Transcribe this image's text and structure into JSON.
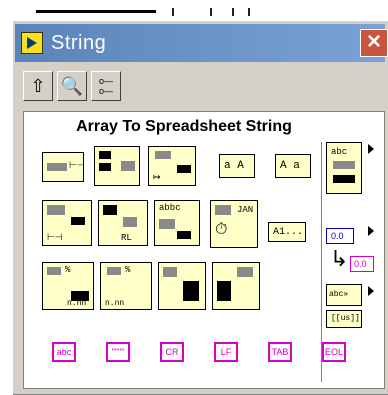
{
  "window": {
    "title": "String",
    "close_label": "×"
  },
  "toolbar": {
    "up_icon": "up-arrow-icon",
    "search_icon": "search-icon",
    "options_icon": "options-icon"
  },
  "palette": {
    "tooltip": "Array To Spreadsheet String",
    "items": {
      "case_a": "a A",
      "case_b": "A a",
      "format_a1": "A1...",
      "numeric": "0.0",
      "numeric_out": "0.0",
      "abc": "abc",
      "jan": "JAN",
      "n_nn": "n.nn"
    },
    "bottom_row": [
      "abc",
      "\"\"\"\"",
      "CR",
      "LF",
      "TAB",
      "EOL"
    ]
  }
}
